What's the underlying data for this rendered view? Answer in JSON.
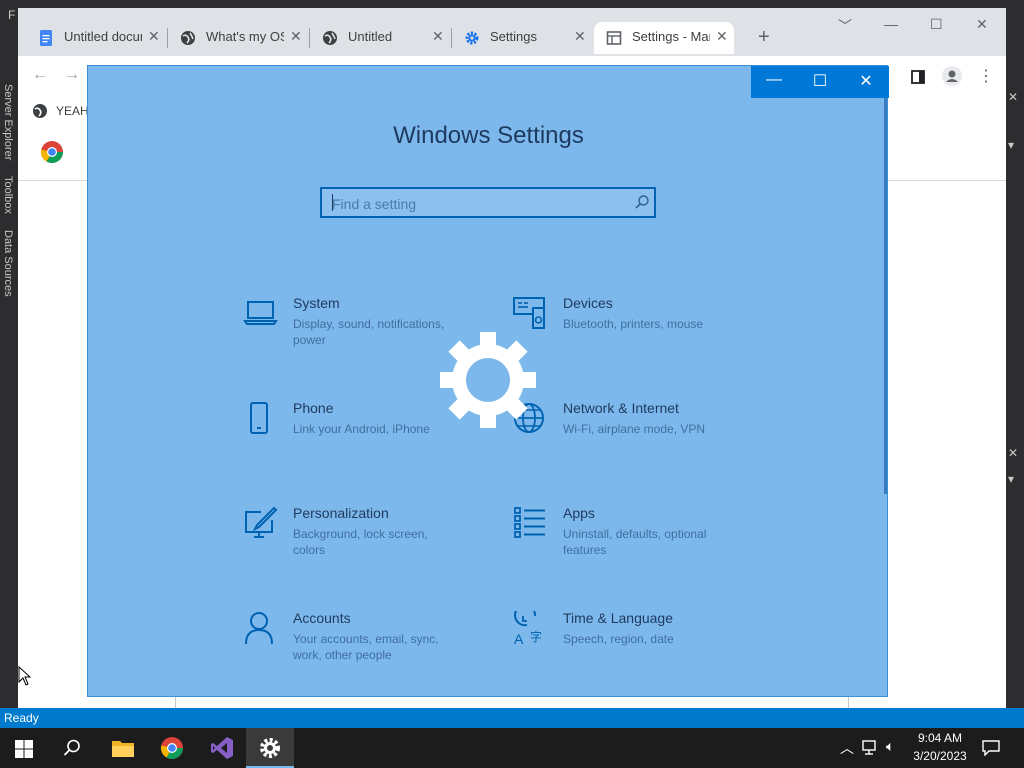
{
  "vs": {
    "menu_letter": "F",
    "left_tabs": [
      "Server Explorer",
      "Toolbox",
      "Data Sources"
    ],
    "status": "Ready"
  },
  "chrome": {
    "tabs": [
      {
        "title": "Untitled docum",
        "icon": "google-docs-icon"
      },
      {
        "title": "What's my OS",
        "icon": "globe-icon"
      },
      {
        "title": "Untitled",
        "icon": "globe-icon"
      },
      {
        "title": "Settings",
        "icon": "gear-icon"
      },
      {
        "title": "Settings - Mar",
        "icon": "page-icon"
      }
    ],
    "bookmark_label": "YEAH"
  },
  "settings": {
    "heading": "Windows Settings",
    "search_placeholder": "Find a setting",
    "items": [
      {
        "name": "System",
        "desc": "Display, sound, notifications, power",
        "icon": "laptop-icon"
      },
      {
        "name": "Devices",
        "desc": "Bluetooth, printers, mouse",
        "icon": "devices-icon"
      },
      {
        "name": "Phone",
        "desc": "Link your Android, iPhone",
        "icon": "phone-icon"
      },
      {
        "name": "Network & Internet",
        "desc": "Wi-Fi, airplane mode, VPN",
        "icon": "globe-icon"
      },
      {
        "name": "Personalization",
        "desc": "Background, lock screen, colors",
        "icon": "paint-icon"
      },
      {
        "name": "Apps",
        "desc": "Uninstall, defaults, optional features",
        "icon": "apps-list-icon"
      },
      {
        "name": "Accounts",
        "desc": "Your accounts, email, sync, work, other people",
        "icon": "person-icon"
      },
      {
        "name": "Time & Language",
        "desc": "Speech, region, date",
        "icon": "time-language-icon"
      }
    ]
  },
  "taskbar": {
    "time": "9:04 AM",
    "date": "3/20/2023"
  }
}
